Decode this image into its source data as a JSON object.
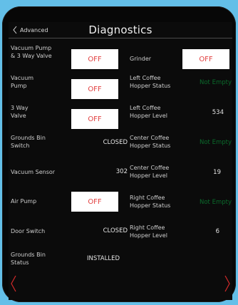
{
  "header": {
    "back_label": "Advanced",
    "title": "Diagnostics"
  },
  "left_column": {
    "vacuum_pump_valve": {
      "label_line1": "Vacuum Pump",
      "label_line2": "& 3 Way Valve",
      "button": "OFF"
    },
    "vacuum_pump": {
      "label_line1": "Vacuum",
      "label_line2": "Pump",
      "button": "OFF"
    },
    "three_way_valve": {
      "label_line1": "3 Way",
      "label_line2": "Valve",
      "button": "OFF"
    },
    "grounds_bin_switch": {
      "label_line1": "Grounds Bin",
      "label_line2": "Switch",
      "value": "CLOSED"
    },
    "vacuum_sensor": {
      "label": "Vacuum Sensor",
      "value": "302"
    },
    "air_pump": {
      "label": "Air Pump",
      "button": "OFF"
    },
    "door_switch": {
      "label": "Door Switch",
      "value": "CLOSED"
    },
    "grounds_bin_status": {
      "label_line1": "Grounds Bin",
      "label_line2": "Status",
      "value": "INSTALLED"
    }
  },
  "right_column": {
    "grinder": {
      "label": "Grinder",
      "button": "OFF"
    },
    "left_hopper_status": {
      "label_line1": "Left Coffee",
      "label_line2": "Hopper Status",
      "value": "Not Empty"
    },
    "left_hopper_level": {
      "label_line1": "Left Coffee",
      "label_line2": "Hopper Level",
      "value": "534"
    },
    "center_hopper_status": {
      "label_line1": "Center Coffee",
      "label_line2": "Hopper Status",
      "value": "Not Empty"
    },
    "center_hopper_level": {
      "label_line1": "Center Coffee",
      "label_line2": "Hopper Level",
      "value": "19"
    },
    "right_hopper_status": {
      "label_line1": "Right Coffee",
      "label_line2": "Hopper Status",
      "value": "Not Empty"
    },
    "right_hopper_level": {
      "label_line1": "Right Coffee",
      "label_line2": "Hopper Level",
      "value": "6"
    }
  },
  "navigation": {
    "prev_icon": "chevron-left-icon",
    "next_icon": "chevron-right-icon"
  },
  "colors": {
    "background": "#63bfe8",
    "device": "#070707",
    "button_bg": "#ffffff",
    "off_text": "#e24040",
    "status_green": "#0a6b2b",
    "nav_arrow": "#d42a2a"
  }
}
